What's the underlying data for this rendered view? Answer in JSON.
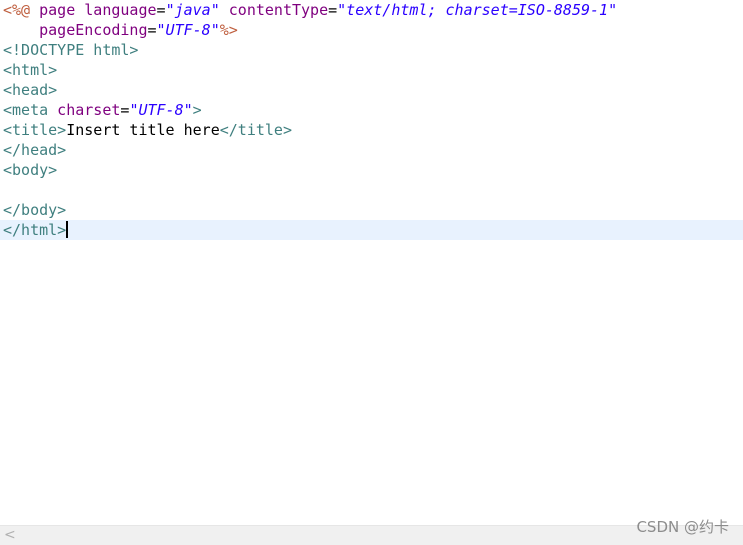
{
  "editor": {
    "lines": [
      {
        "id": "jsp-directive",
        "tokens": [
          {
            "t": "jsp",
            "v": "<%@"
          },
          {
            "t": "attr",
            "v": " page "
          },
          {
            "t": "attr",
            "v": "language"
          },
          {
            "t": "text",
            "v": "="
          },
          {
            "t": "val",
            "v": "\"java\""
          },
          {
            "t": "attr",
            "v": " contentType"
          },
          {
            "t": "text",
            "v": "="
          },
          {
            "t": "val",
            "v": "\"text/html; charset=ISO-8859-1\""
          }
        ]
      },
      {
        "id": "jsp-directive-cont",
        "tokens": [
          {
            "t": "attr",
            "v": "    pageEncoding"
          },
          {
            "t": "text",
            "v": "="
          },
          {
            "t": "val",
            "v": "\"UTF-8\""
          },
          {
            "t": "jsp",
            "v": "%>"
          }
        ]
      },
      {
        "id": "doctype",
        "tokens": [
          {
            "t": "tag",
            "v": "<!DOCTYPE html>"
          }
        ]
      },
      {
        "id": "html-open",
        "tokens": [
          {
            "t": "tag",
            "v": "<html>"
          }
        ]
      },
      {
        "id": "head-open",
        "tokens": [
          {
            "t": "tag",
            "v": "<head>"
          }
        ]
      },
      {
        "id": "meta",
        "tokens": [
          {
            "t": "tag",
            "v": "<meta"
          },
          {
            "t": "attr",
            "v": " charset"
          },
          {
            "t": "text",
            "v": "="
          },
          {
            "t": "val",
            "v": "\"UTF-8\""
          },
          {
            "t": "tag",
            "v": ">"
          }
        ]
      },
      {
        "id": "title",
        "tokens": [
          {
            "t": "tag",
            "v": "<title>"
          },
          {
            "t": "text",
            "v": "Insert title here"
          },
          {
            "t": "tag",
            "v": "</title>"
          }
        ]
      },
      {
        "id": "head-close",
        "tokens": [
          {
            "t": "tag",
            "v": "</head>"
          }
        ]
      },
      {
        "id": "body-open",
        "tokens": [
          {
            "t": "tag",
            "v": "<body>"
          }
        ]
      },
      {
        "id": "blank",
        "tokens": []
      },
      {
        "id": "body-close",
        "tokens": [
          {
            "t": "tag",
            "v": "</body>"
          }
        ]
      },
      {
        "id": "html-close",
        "current": true,
        "tokens": [
          {
            "t": "tag",
            "v": "</html>"
          }
        ]
      }
    ]
  },
  "scrollbar": {
    "left_arrow": "<"
  },
  "watermark": "CSDN @约卡",
  "colors": {
    "jsp_delimiter": "#bf5f3f",
    "tag": "#3f7f7f",
    "attribute": "#7f007f",
    "value": "#2a00ff",
    "current_line": "#e8f2fe"
  }
}
